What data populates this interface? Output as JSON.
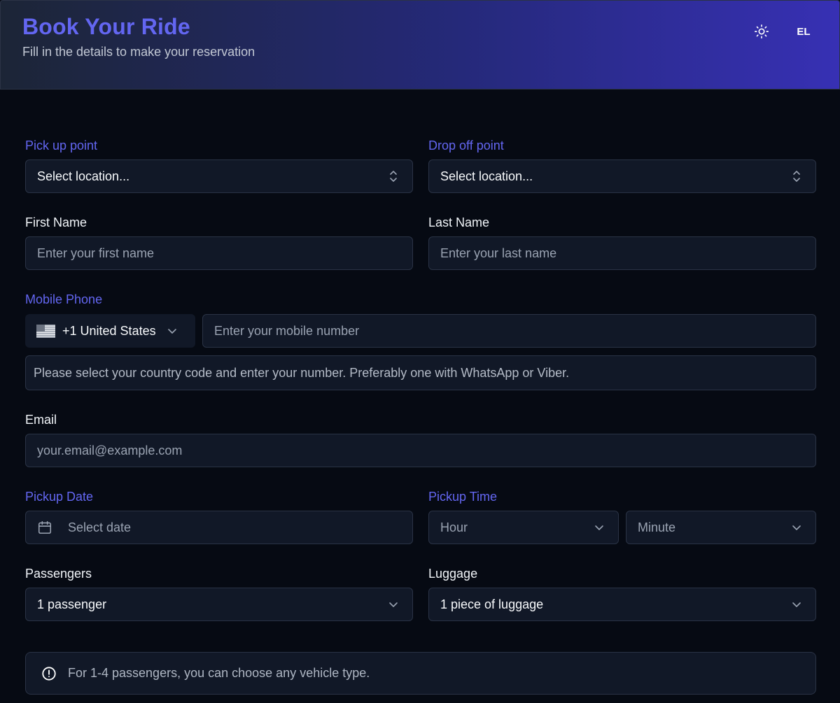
{
  "header": {
    "title": "Book Your Ride",
    "subtitle": "Fill in the details to make your reservation",
    "language": "EL",
    "theme_icon": "sun-icon"
  },
  "form": {
    "pickup": {
      "label": "Pick up point",
      "placeholder": "Select location..."
    },
    "dropoff": {
      "label": "Drop off point",
      "placeholder": "Select location..."
    },
    "first_name": {
      "label": "First Name",
      "placeholder": "Enter your first name"
    },
    "last_name": {
      "label": "Last Name",
      "placeholder": "Enter your last name"
    },
    "phone": {
      "label": "Mobile Phone",
      "country": "+1 United States",
      "country_flag_icon": "us-flag-icon",
      "placeholder": "Enter your mobile number",
      "hint": "Please select your country code and enter your number. Preferably one with WhatsApp or Viber."
    },
    "email": {
      "label": "Email",
      "placeholder": "your.email@example.com"
    },
    "pickup_date": {
      "label": "Pickup Date",
      "placeholder": "Select date"
    },
    "pickup_time": {
      "label": "Pickup Time",
      "hour_placeholder": "Hour",
      "minute_placeholder": "Minute"
    },
    "passengers": {
      "label": "Passengers",
      "value": "1 passenger"
    },
    "luggage": {
      "label": "Luggage",
      "value": "1 piece of luggage"
    },
    "notice": "For 1-4 passengers, you can choose any vehicle type."
  },
  "colors": {
    "accent": "#6366f1",
    "background": "#060a13",
    "field_background": "#111827",
    "header_gradient_end": "#3730b4"
  }
}
